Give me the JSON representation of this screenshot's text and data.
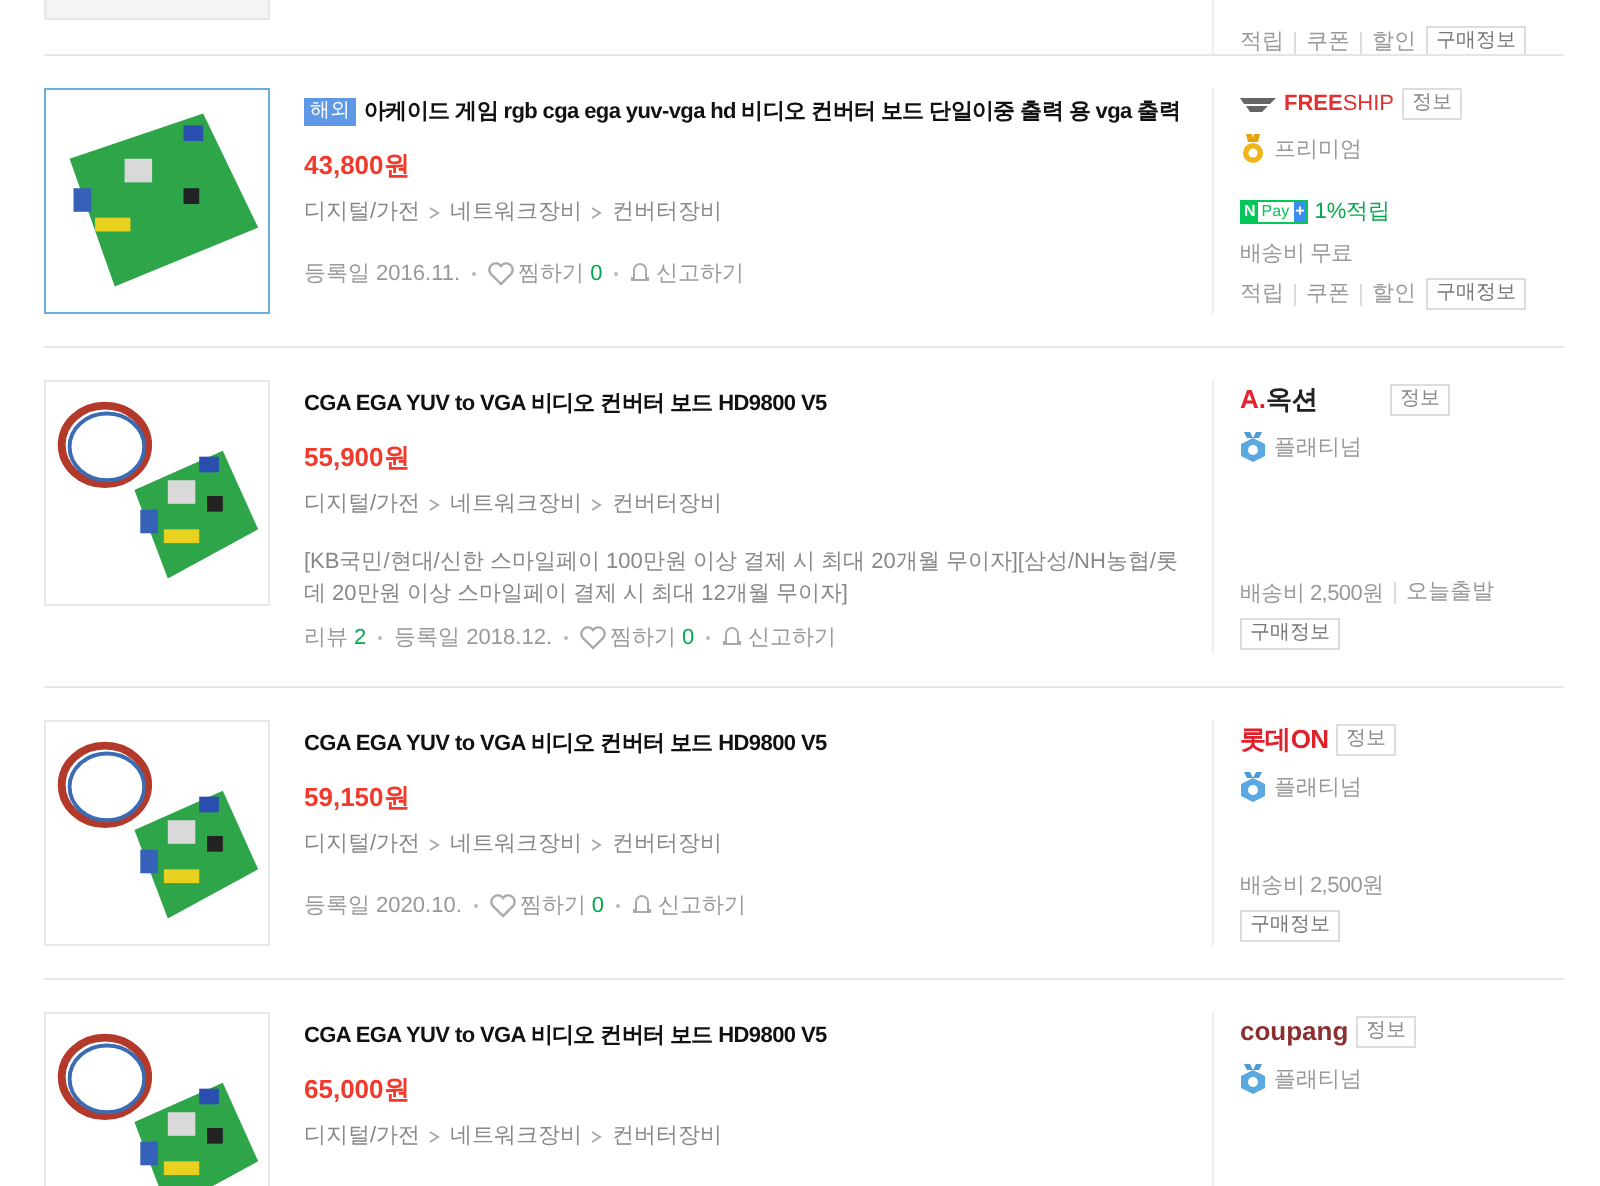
{
  "top_partial": {
    "links": [
      "적립",
      "쿠폰",
      "할인"
    ],
    "purchase_info": "구매정보"
  },
  "products": [
    {
      "badge": "해외",
      "title": "아케이드 게임 rgb cga ega yuv-vga hd 비디오 컨버터 보드 단일이중 출력 용 vga 출력",
      "price": "43,800원",
      "category": [
        "디지털/가전",
        "네트워크장비",
        "컨버터장비"
      ],
      "image_selected": true,
      "meta": {
        "registered": "등록일 2016.11.",
        "wish": "찜하기",
        "wish_count": "0",
        "report": "신고하기"
      },
      "seller": {
        "logo": {
          "kind": "freeship",
          "parts": [
            "FREE",
            "SHIP"
          ]
        },
        "info": "정보",
        "grade": {
          "kind": "medal",
          "label": "프리미엄"
        },
        "npay": {
          "n": "N",
          "pay": "Pay",
          "plus": "+",
          "points": "1%적립"
        },
        "shipping": [
          "배송비 무료"
        ],
        "links": [
          "적립",
          "쿠폰",
          "할인"
        ],
        "purchase_info": "구매정보"
      }
    },
    {
      "title": "CGA EGA YUV to VGA 비디오 컨버터 보드 HD9800 V5",
      "price": "55,900원",
      "category": [
        "디지털/가전",
        "네트워크장비",
        "컨버터장비"
      ],
      "image_selected": false,
      "description": "[KB국민/현대/신한 스마일페이 100만원 이상 결제 시 최대 20개월 무이자][삼성/NH농협/롯데 20만원 이상 스마일페이 결제 시 최대 12개월 무이자]",
      "meta": {
        "review": "리뷰",
        "review_count": "2",
        "registered": "등록일 2018.12.",
        "wish": "찜하기",
        "wish_count": "0",
        "report": "신고하기"
      },
      "seller": {
        "logo": {
          "kind": "auction",
          "parts": [
            "A.",
            "옥션"
          ]
        },
        "info": "정보",
        "grade": {
          "kind": "shield",
          "label": "플래티넘"
        },
        "shipping": [
          "배송비 2,500원",
          "오늘출발"
        ],
        "purchase_info": "구매정보"
      }
    },
    {
      "title": "CGA EGA YUV to VGA 비디오 컨버터 보드 HD9800 V5",
      "price": "59,150원",
      "category": [
        "디지털/가전",
        "네트워크장비",
        "컨버터장비"
      ],
      "image_selected": false,
      "meta": {
        "registered": "등록일 2020.10.",
        "wish": "찜하기",
        "wish_count": "0",
        "report": "신고하기"
      },
      "seller": {
        "logo": {
          "kind": "lotteon",
          "parts": [
            "롯데",
            "ON"
          ]
        },
        "info": "정보",
        "grade": {
          "kind": "shield",
          "label": "플래티넘"
        },
        "shipping": [
          "배송비 2,500원"
        ],
        "purchase_info": "구매정보"
      }
    },
    {
      "title": "CGA EGA YUV to VGA 비디오 컨버터 보드 HD9800 V5",
      "price": "65,000원",
      "category": [
        "디지털/가전",
        "네트워크장비",
        "컨버터장비"
      ],
      "image_selected": false,
      "seller": {
        "logo": {
          "kind": "coupang",
          "parts": [
            "coupang"
          ]
        },
        "info": "정보",
        "grade": {
          "kind": "shield",
          "label": "플래티넘"
        }
      }
    }
  ]
}
